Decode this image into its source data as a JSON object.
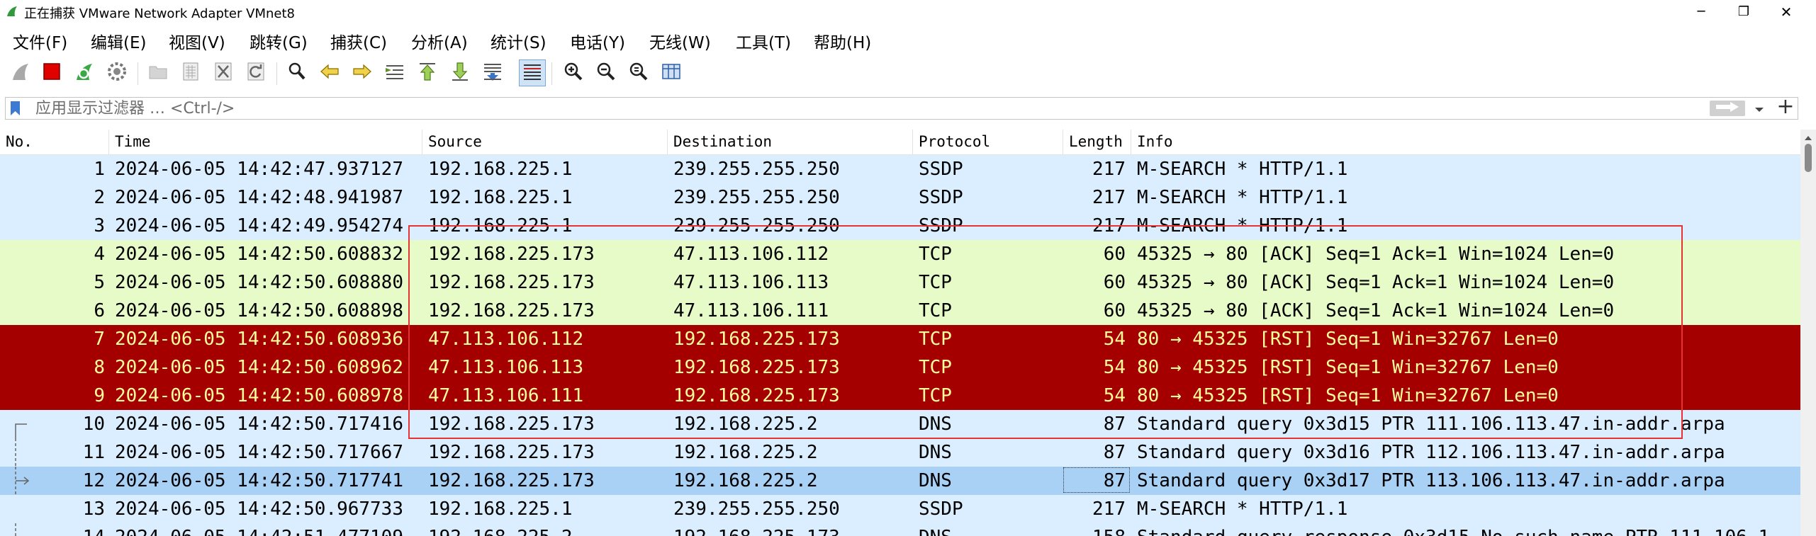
{
  "window": {
    "title": "正在捕获 VMware Network Adapter VMnet8",
    "minimize_glyph": "─",
    "restore_glyph": "❐",
    "close_glyph": "✕"
  },
  "menu": [
    {
      "label": "文件(F)"
    },
    {
      "label": "编辑(E)"
    },
    {
      "label": "视图(V)"
    },
    {
      "label": "跳转(G)"
    },
    {
      "label": "捕获(C)"
    },
    {
      "label": "分析(A)"
    },
    {
      "label": "统计(S)"
    },
    {
      "label": "电话(Y)"
    },
    {
      "label": "无线(W)"
    },
    {
      "label": "工具(T)"
    },
    {
      "label": "帮助(H)"
    }
  ],
  "filter": {
    "placeholder": "应用显示过滤器 … <Ctrl-/>",
    "add_glyph": "+"
  },
  "columns": [
    "No.",
    "Time",
    "Source",
    "Destination",
    "Protocol",
    "Length",
    "Info"
  ],
  "colors": {
    "ssdp_bg": "#daeeff",
    "tcp_bg": "#e7fbc8",
    "rst_bg": "#a40000",
    "rst_fg": "#fffc9c",
    "dns_bg": "#daeeff",
    "selected_bg": "#a9d1f5",
    "highlight_border": "#e33333"
  },
  "packets": [
    {
      "no": "1",
      "time": "2024-06-05 14:42:47.937127",
      "src": "192.168.225.1",
      "dst": "239.255.255.250",
      "proto": "SSDP",
      "len": "217",
      "info": "M-SEARCH * HTTP/1.1",
      "style": "ssdp"
    },
    {
      "no": "2",
      "time": "2024-06-05 14:42:48.941987",
      "src": "192.168.225.1",
      "dst": "239.255.255.250",
      "proto": "SSDP",
      "len": "217",
      "info": "M-SEARCH * HTTP/1.1",
      "style": "ssdp"
    },
    {
      "no": "3",
      "time": "2024-06-05 14:42:49.954274",
      "src": "192.168.225.1",
      "dst": "239.255.255.250",
      "proto": "SSDP",
      "len": "217",
      "info": "M-SEARCH * HTTP/1.1",
      "style": "ssdp"
    },
    {
      "no": "4",
      "time": "2024-06-05 14:42:50.608832",
      "src": "192.168.225.173",
      "dst": "47.113.106.112",
      "proto": "TCP",
      "len": "60",
      "info": "45325 → 80 [ACK] Seq=1 Ack=1 Win=1024 Len=0",
      "style": "tcp"
    },
    {
      "no": "5",
      "time": "2024-06-05 14:42:50.608880",
      "src": "192.168.225.173",
      "dst": "47.113.106.113",
      "proto": "TCP",
      "len": "60",
      "info": "45325 → 80 [ACK] Seq=1 Ack=1 Win=1024 Len=0",
      "style": "tcp"
    },
    {
      "no": "6",
      "time": "2024-06-05 14:42:50.608898",
      "src": "192.168.225.173",
      "dst": "47.113.106.111",
      "proto": "TCP",
      "len": "60",
      "info": "45325 → 80 [ACK] Seq=1 Ack=1 Win=1024 Len=0",
      "style": "tcp"
    },
    {
      "no": "7",
      "time": "2024-06-05 14:42:50.608936",
      "src": "47.113.106.112",
      "dst": "192.168.225.173",
      "proto": "TCP",
      "len": "54",
      "info": "80 → 45325 [RST] Seq=1 Win=32767 Len=0",
      "style": "rst"
    },
    {
      "no": "8",
      "time": "2024-06-05 14:42:50.608962",
      "src": "47.113.106.113",
      "dst": "192.168.225.173",
      "proto": "TCP",
      "len": "54",
      "info": "80 → 45325 [RST] Seq=1 Win=32767 Len=0",
      "style": "rst"
    },
    {
      "no": "9",
      "time": "2024-06-05 14:42:50.608978",
      "src": "47.113.106.111",
      "dst": "192.168.225.173",
      "proto": "TCP",
      "len": "54",
      "info": "80 → 45325 [RST] Seq=1 Win=32767 Len=0",
      "style": "rst"
    },
    {
      "no": "10",
      "time": "2024-06-05 14:42:50.717416",
      "src": "192.168.225.173",
      "dst": "192.168.225.2",
      "proto": "DNS",
      "len": "87",
      "info": "Standard query 0x3d15 PTR 111.106.113.47.in-addr.arpa",
      "style": "dns"
    },
    {
      "no": "11",
      "time": "2024-06-05 14:42:50.717667",
      "src": "192.168.225.173",
      "dst": "192.168.225.2",
      "proto": "DNS",
      "len": "87",
      "info": "Standard query 0x3d16 PTR 112.106.113.47.in-addr.arpa",
      "style": "dns"
    },
    {
      "no": "12",
      "time": "2024-06-05 14:42:50.717741",
      "src": "192.168.225.173",
      "dst": "192.168.225.2",
      "proto": "DNS",
      "len": "87",
      "info": "Standard query 0x3d17 PTR 113.106.113.47.in-addr.arpa",
      "style": "selected"
    },
    {
      "no": "13",
      "time": "2024-06-05 14:42:50.967733",
      "src": "192.168.225.1",
      "dst": "239.255.255.250",
      "proto": "SSDP",
      "len": "217",
      "info": "M-SEARCH * HTTP/1.1",
      "style": "ssdp"
    },
    {
      "no": "14",
      "time": "2024-06-05 14:42:51.477109",
      "src": "192.168.225.2",
      "dst": "192.168.225.173",
      "proto": "DNS",
      "len": "158",
      "info": "Standard query response 0x3d15 No such name PTR 111.106.1",
      "style": "dns"
    }
  ]
}
